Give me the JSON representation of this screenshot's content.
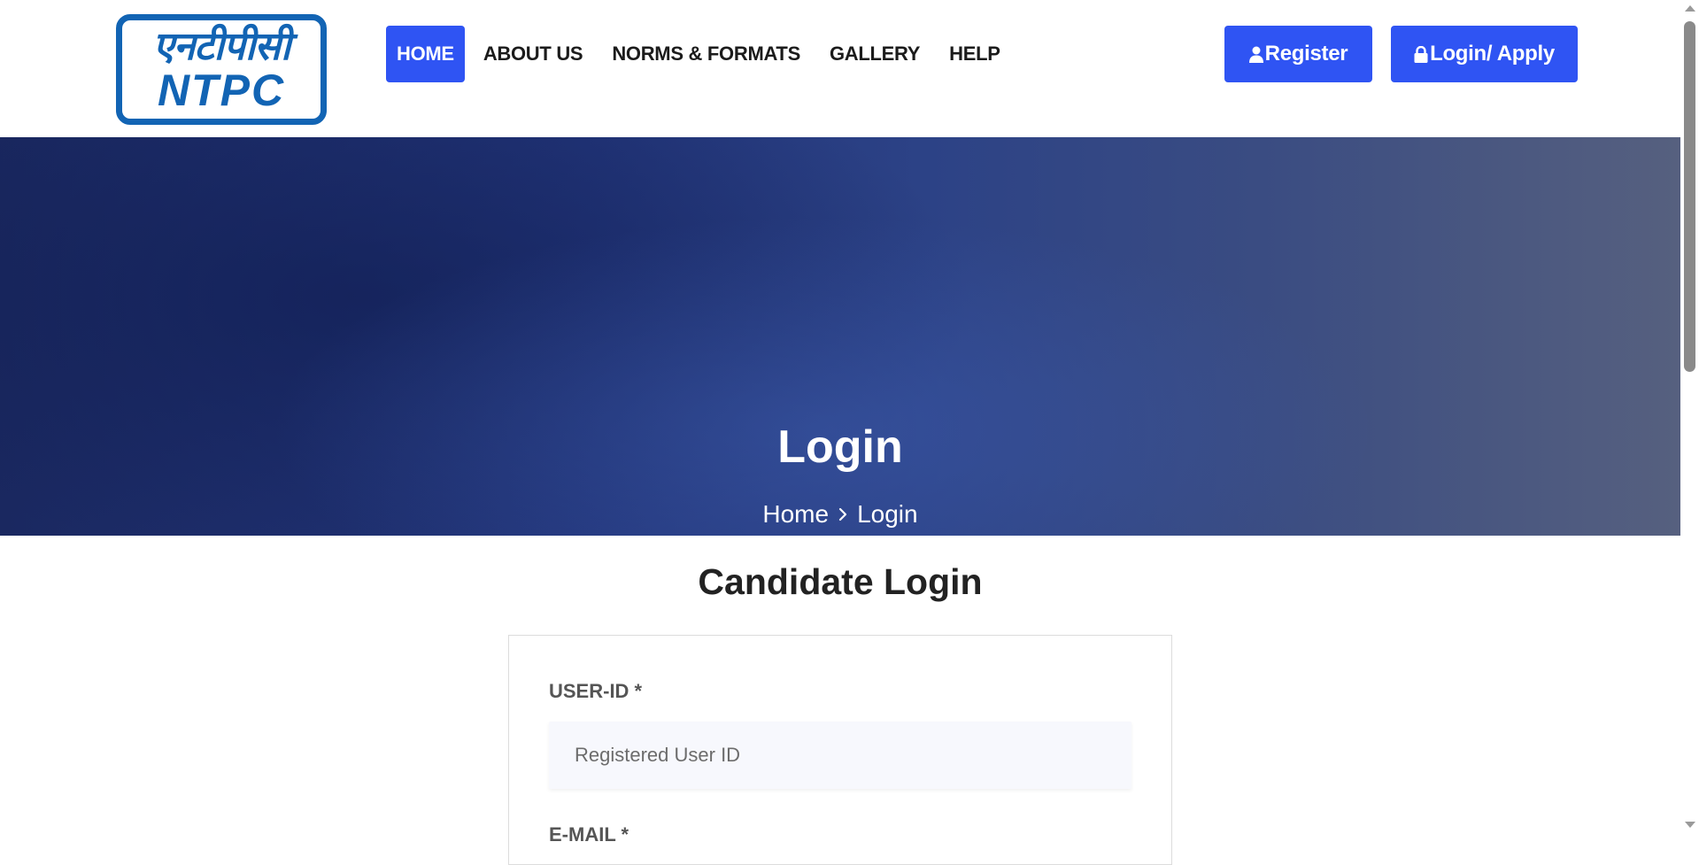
{
  "header": {
    "logo": {
      "hindi_text": "एनटीपीसी",
      "english_text": "NTPC"
    },
    "nav": [
      {
        "label": "HOME",
        "active": true
      },
      {
        "label": "ABOUT US",
        "active": false
      },
      {
        "label": "NORMS & FORMATS",
        "active": false
      },
      {
        "label": "GALLERY",
        "active": false
      },
      {
        "label": "HELP",
        "active": false
      }
    ],
    "register_label": "Register",
    "login_label": "Login/ Apply"
  },
  "hero": {
    "title": "Login",
    "breadcrumb": {
      "home": "Home",
      "current": "Login"
    }
  },
  "login_form": {
    "heading": "Candidate Login",
    "userid_label": "USER-ID *",
    "userid_placeholder": "Registered User ID",
    "userid_value": "",
    "email_label": "E-MAIL *"
  },
  "colors": {
    "accent": "#2f54f3",
    "logo_blue": "#1264b4",
    "hero_dark": "#1a2860"
  },
  "icons": {
    "register": "user-icon",
    "login": "lock-icon",
    "breadcrumb_separator": "chevron-right-icon"
  }
}
